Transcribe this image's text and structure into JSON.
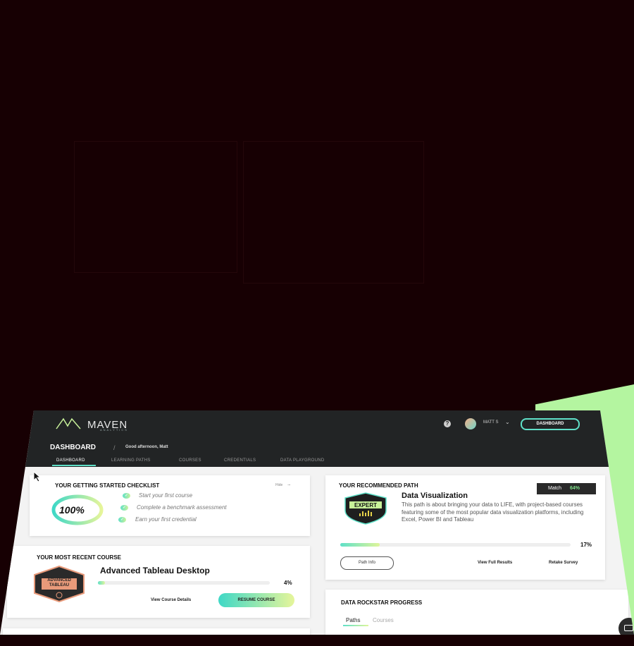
{
  "app": {
    "brand": "MAVEN",
    "brand_sub": "ANALYTICS",
    "help_icon": "?",
    "user_name": "MATT S",
    "dashboard_button": "DASHBOARD"
  },
  "header": {
    "title": "DASHBOARD",
    "separator": "/",
    "greeting": "Good afternoon, Matt"
  },
  "tabs": [
    {
      "label": "DASHBOARD",
      "active": true
    },
    {
      "label": "LEARNING PATHS",
      "active": false
    },
    {
      "label": "COURSES",
      "active": false
    },
    {
      "label": "CREDENTIALS",
      "active": false
    },
    {
      "label": "DATA PLAYGROUND",
      "active": false
    }
  ],
  "checklist": {
    "title": "YOUR GETTING STARTED CHECKLIST",
    "hide_label": "Hide",
    "progress": "100%",
    "progress_fraction": 1.0,
    "items": [
      "Start your first course",
      "Complete a benchmark assessment",
      "Earn your first credential"
    ]
  },
  "recent_course": {
    "title": "YOUR MOST RECENT COURSE",
    "badge_text": "ADVANCED TABLEAU",
    "course_name": "Advanced Tableau Desktop",
    "progress": "4%",
    "progress_fraction": 0.04,
    "details_link": "View Course Details",
    "resume_label": "RESUME COURSE"
  },
  "recommended": {
    "title": "YOUR RECOMMENDED PATH",
    "match_label": "Match",
    "match_value": "64%",
    "badge_text": "EXPERT",
    "path_name": "Data Visualization",
    "description": "This path is about bringing your data to LIFE, with project-based courses featuring some of the most popular data visualization platforms, including Excel, Power BI and Tableau",
    "progress": "17%",
    "progress_fraction": 0.17,
    "path_info": "Path Info",
    "view_results": "View Full Results",
    "retake": "Retake Survey"
  },
  "rockstar": {
    "title": "DATA ROCKSTAR PROGRESS",
    "subtabs": [
      "Paths",
      "Courses"
    ]
  },
  "colors": {
    "accent": "#5fe0c8",
    "accent2": "#dff59a",
    "background": "#170003",
    "nav": "#222425",
    "green_shape": "#b4f5a0"
  }
}
